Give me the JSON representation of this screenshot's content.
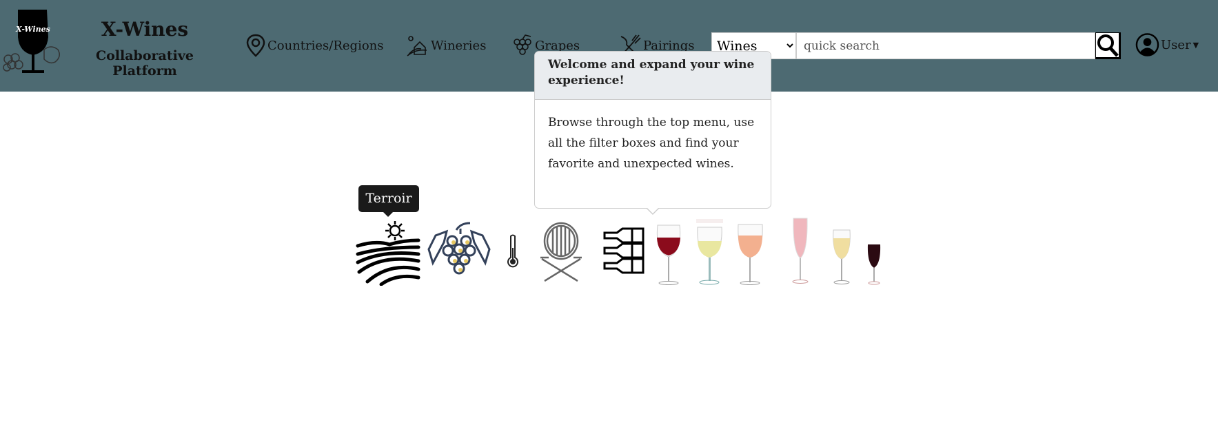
{
  "brand": {
    "logo_text": "X-Wines",
    "title": "X-Wines",
    "subtitle": "Collaborative Platform"
  },
  "nav": [
    {
      "label": "Countries/Regions",
      "icon": "map-pin-icon"
    },
    {
      "label": "Wineries",
      "icon": "winery-icon"
    },
    {
      "label": "Grapes",
      "icon": "grapes-icon"
    },
    {
      "label": "Pairings",
      "icon": "fork-knife-icon"
    }
  ],
  "search": {
    "category": "Wines",
    "placeholder": "quick search",
    "value": ""
  },
  "user": {
    "label": "User"
  },
  "popover": {
    "title": "Welcome and expand your wine experience!",
    "body": "Browse through the top menu, use all the filter boxes and find your favorite and unexpected wines."
  },
  "tooltip": {
    "label": "Terroir"
  },
  "icons": [
    "terroir",
    "grape",
    "thermometer",
    "barrel",
    "wine-rack",
    "red-wine",
    "white-wine",
    "rose-wine",
    "sparkling-wine",
    "dessert-wine",
    "fortified-wine"
  ],
  "colors": {
    "header": "#4d6a72",
    "red": "#8b0b1c",
    "white": "#e9e7a0",
    "rose": "#f3b08f",
    "sparkling": "#f0b7bd",
    "dessert": "#f0dea0",
    "fortified": "#2b0a12"
  }
}
